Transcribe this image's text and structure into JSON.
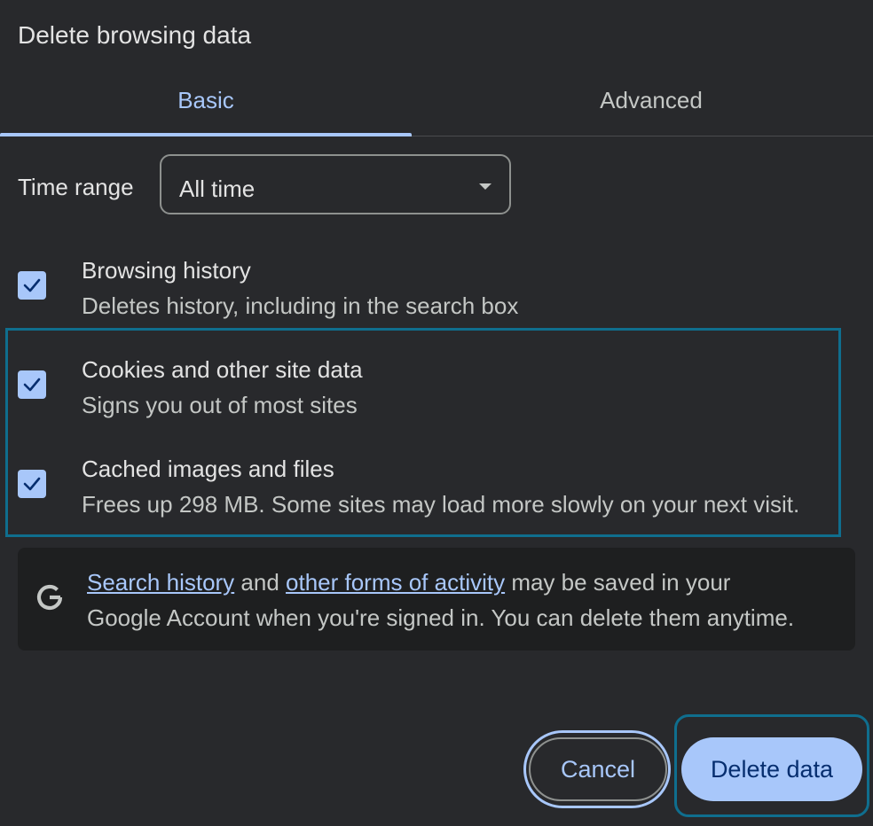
{
  "dialog": {
    "title": "Delete browsing data"
  },
  "tabs": [
    {
      "label": "Basic",
      "selected": true
    },
    {
      "label": "Advanced",
      "selected": false
    }
  ],
  "time_range": {
    "label": "Time range",
    "value": "All time"
  },
  "options": [
    {
      "title": "Browsing history",
      "description": "Deletes history, including in the search box",
      "checked": true
    },
    {
      "title": "Cookies and other site data",
      "description": "Signs you out of most sites",
      "checked": true
    },
    {
      "title": "Cached images and files",
      "description": "Frees up 298 MB. Some sites may load more slowly on your next visit.",
      "checked": true
    }
  ],
  "info": {
    "link1": "Search history",
    "text1": " and ",
    "link2": "other forms of activity",
    "text2": " may be saved in your",
    "line2": "Google Account when you're signed in. You can delete them anytime.",
    "icon": "google-g-icon"
  },
  "buttons": {
    "cancel": "Cancel",
    "delete": "Delete data"
  },
  "colors": {
    "background": "#28292c",
    "accent": "#a8c7fa",
    "focus_ring": "#0f6e8e",
    "info_bg": "#1e1f20"
  }
}
